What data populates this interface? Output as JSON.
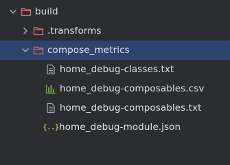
{
  "tree": {
    "build": {
      "label": "build",
      "icon": "folder-excluded-icon",
      "expanded": true,
      "icon_color": "#e06c75"
    },
    "transforms": {
      "label": ".transforms",
      "icon": "folder-excluded-icon",
      "expanded": false,
      "icon_color": "#e06c75"
    },
    "compose_metrics": {
      "label": "compose_metrics",
      "icon": "folder-excluded-icon",
      "expanded": true,
      "selected": true,
      "icon_color": "#e06c75"
    },
    "files": [
      {
        "label": "home_debug-classes.txt",
        "icon": "text-file-icon"
      },
      {
        "label": "home_debug-composables.csv",
        "icon": "csv-chart-icon",
        "icon_color": "#6fa33c"
      },
      {
        "label": "home_debug-composables.txt",
        "icon": "text-file-icon"
      },
      {
        "label": "home_debug-module.json",
        "icon": "json-braces-icon",
        "icon_glyph": "{..}",
        "icon_color": "#c9b44f"
      }
    ]
  },
  "colors": {
    "background": "#2b2d30",
    "selection": "#2e436e",
    "text": "#dfe1e5",
    "chevron": "#a8adb5",
    "file_icon": "#a8adb5"
  }
}
